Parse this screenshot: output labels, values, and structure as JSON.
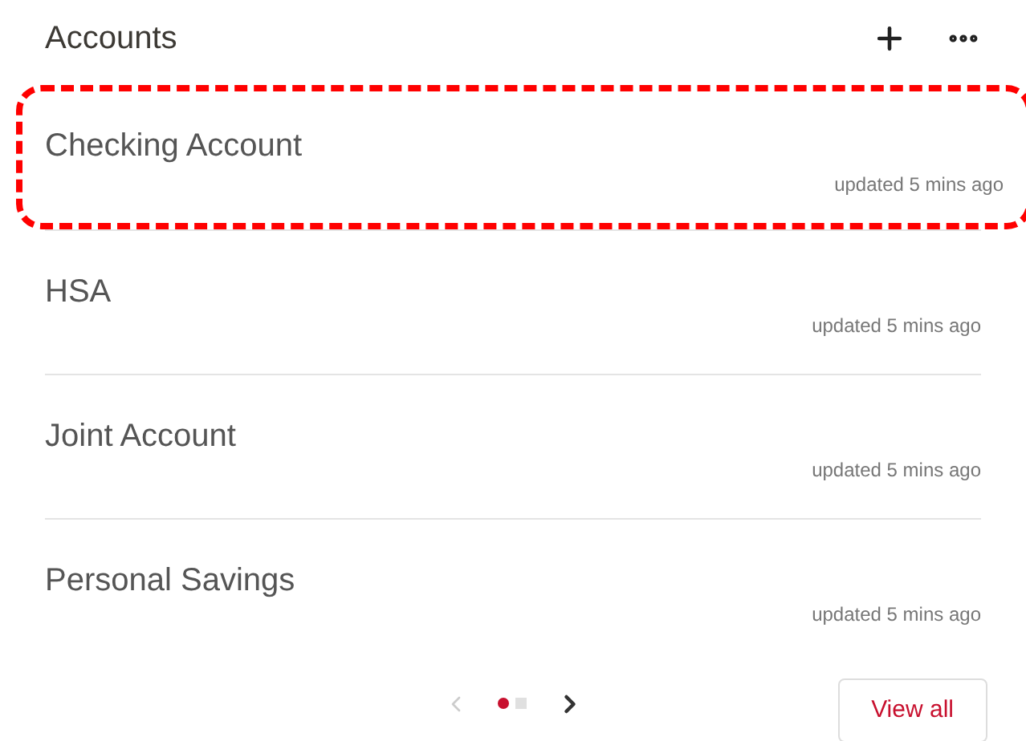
{
  "header": {
    "title": "Accounts"
  },
  "accounts": [
    {
      "name": "Checking Account",
      "updated": "updated 5 mins ago",
      "highlighted": true
    },
    {
      "name": "HSA",
      "updated": "updated 5 mins ago",
      "highlighted": false
    },
    {
      "name": "Joint Account",
      "updated": "updated 5 mins ago",
      "highlighted": false
    },
    {
      "name": "Personal Savings",
      "updated": "updated 5 mins ago",
      "highlighted": false
    }
  ],
  "pager": {
    "prev_disabled": true,
    "next_disabled": false,
    "pages": [
      {
        "selected": true
      },
      {
        "selected": false
      }
    ]
  },
  "view_all": "View all"
}
